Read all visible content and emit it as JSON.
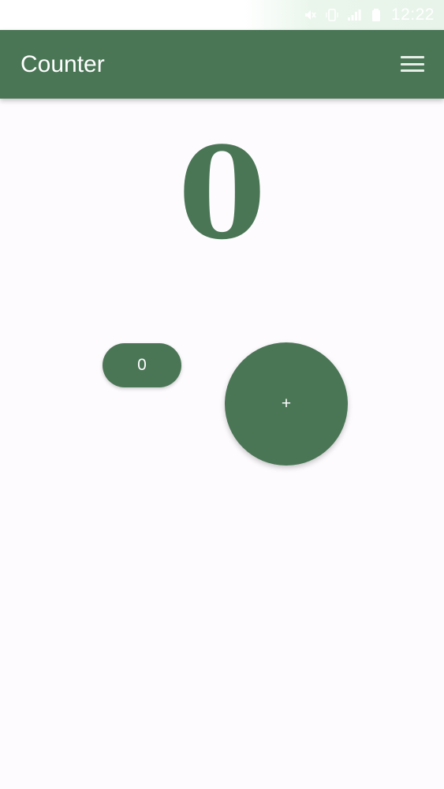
{
  "status_bar": {
    "time": "12:22",
    "icons": [
      "mute-icon",
      "vibrate-icon",
      "signal-icon",
      "battery-icon"
    ]
  },
  "app_bar": {
    "title": "Counter",
    "menu_icon": "menu-icon"
  },
  "counter": {
    "value": "0"
  },
  "buttons": {
    "reset_label": "0",
    "increment_label": "+"
  },
  "colors": {
    "primary": "#4a7656",
    "background": "#fdfbfd",
    "on_primary": "#ffffff"
  }
}
